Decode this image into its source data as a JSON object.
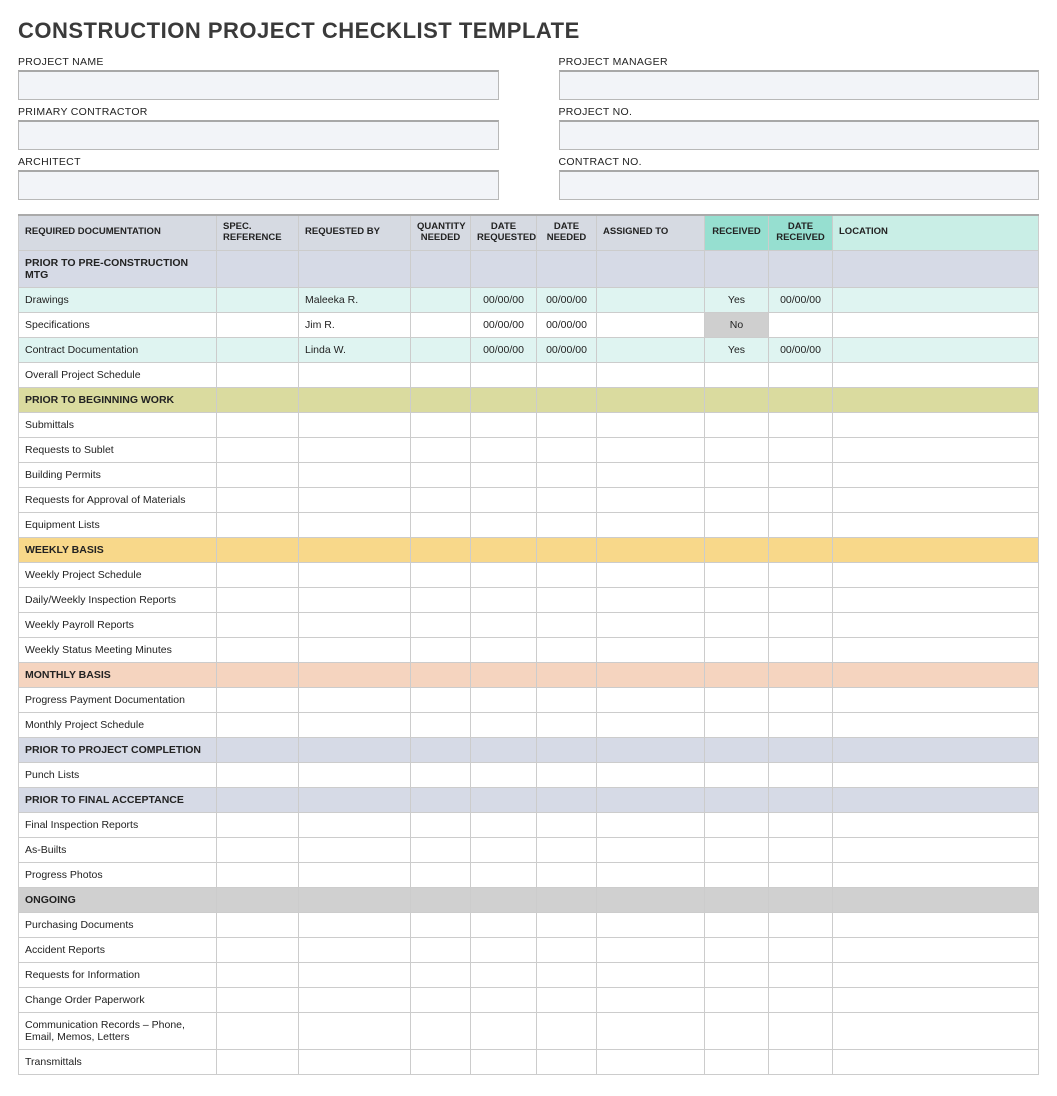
{
  "title": "CONSTRUCTION PROJECT CHECKLIST TEMPLATE",
  "info_fields": {
    "left": [
      "PROJECT NAME",
      "PRIMARY CONTRACTOR",
      "ARCHITECT"
    ],
    "right": [
      "PROJECT MANAGER",
      "PROJECT NO.",
      "CONTRACT NO."
    ]
  },
  "columns": [
    "REQUIRED DOCUMENTATION",
    "SPEC. REFERENCE",
    "REQUESTED BY",
    "QUANTITY NEEDED",
    "DATE REQUESTED",
    "DATE NEEDED",
    "ASSIGNED TO",
    "RECEIVED",
    "DATE RECEIVED",
    "LOCATION"
  ],
  "sections": [
    {
      "label": "PRIOR TO PRE-CONSTRUCTION MTG",
      "class": "sec-lav",
      "rows": [
        {
          "doc": "Drawings",
          "reqby": "Maleeka R.",
          "dreq": "00/00/00",
          "dneed": "00/00/00",
          "received": "Yes",
          "drecv": "00/00/00",
          "rowClass": "row-pale"
        },
        {
          "doc": "Specifications",
          "reqby": "Jim R.",
          "dreq": "00/00/00",
          "dneed": "00/00/00",
          "received": "No"
        },
        {
          "doc": "Contract Documentation",
          "reqby": "Linda W.",
          "dreq": "00/00/00",
          "dneed": "00/00/00",
          "received": "Yes",
          "drecv": "00/00/00",
          "rowClass": "row-pale"
        },
        {
          "doc": "Overall Project Schedule"
        }
      ]
    },
    {
      "label": "PRIOR TO BEGINNING WORK",
      "class": "sec-olive",
      "rows": [
        {
          "doc": "Submittals"
        },
        {
          "doc": "Requests to Sublet"
        },
        {
          "doc": "Building Permits"
        },
        {
          "doc": "Requests for Approval of Materials"
        },
        {
          "doc": "Equipment Lists"
        }
      ]
    },
    {
      "label": "WEEKLY BASIS",
      "class": "sec-yellow",
      "rows": [
        {
          "doc": "Weekly Project Schedule"
        },
        {
          "doc": "Daily/Weekly Inspection Reports"
        },
        {
          "doc": "Weekly Payroll Reports"
        },
        {
          "doc": "Weekly Status Meeting Minutes"
        }
      ]
    },
    {
      "label": "MONTHLY BASIS",
      "class": "sec-peach",
      "rows": [
        {
          "doc": "Progress Payment Documentation"
        },
        {
          "doc": "Monthly Project Schedule"
        }
      ]
    },
    {
      "label": "PRIOR TO PROJECT COMPLETION",
      "class": "sec-lav",
      "rows": [
        {
          "doc": "Punch Lists"
        }
      ]
    },
    {
      "label": "PRIOR TO FINAL ACCEPTANCE",
      "class": "sec-lav",
      "rows": [
        {
          "doc": "Final Inspection Reports"
        },
        {
          "doc": "As-Builts"
        },
        {
          "doc": "Progress Photos"
        }
      ]
    },
    {
      "label": "ONGOING",
      "class": "sec-grey",
      "rows": [
        {
          "doc": "Purchasing Documents"
        },
        {
          "doc": "Accident Reports"
        },
        {
          "doc": "Requests for Information"
        },
        {
          "doc": "Change Order Paperwork"
        },
        {
          "doc": "Communication Records – Phone, Email, Memos, Letters"
        },
        {
          "doc": "Transmittals"
        }
      ]
    }
  ]
}
